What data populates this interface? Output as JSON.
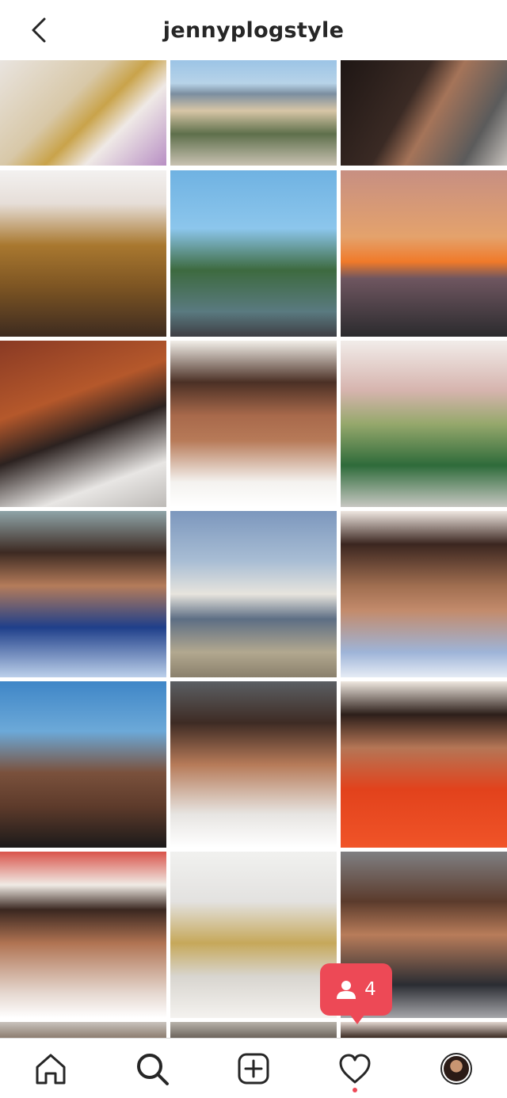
{
  "header": {
    "username": "jennyplogstyle",
    "back_icon": "chevron-left-icon"
  },
  "grid": {
    "posts": [
      {
        "name": "post-perfume-flatlay",
        "bg": "linear-gradient(135deg,#e9e4df 0%,#d8c8a8 40%,#c9a34a 55%,#efe9e6 70%,#b88fc4 100%)"
      },
      {
        "name": "post-coastline",
        "bg": "linear-gradient(180deg,#9cc4e6 0%,#b7d3e8 22%,#7b8ea0 32%,#d7c6a6 48%,#5e6f4b 70%,#c9c2b2 100%)"
      },
      {
        "name": "post-portrait-dark",
        "bg": "linear-gradient(120deg,#1e1614 0%,#3a2a24 40%,#a57459 55%,#5b5b5b 80%,#c7c2bd 100%)"
      },
      {
        "name": "post-leopard-dress",
        "bg": "linear-gradient(180deg,#f3f1f0 0%,#e6ded8 20%,#a9782f 45%,#7d5523 70%,#3d2b20 100%)"
      },
      {
        "name": "post-palm-street",
        "bg": "linear-gradient(180deg,#6fb2e2 0%,#8cc6ec 35%,#3d6a3f 60%,#5a7a80 85%,#3e3e44 100%)"
      },
      {
        "name": "post-sunset",
        "bg": "linear-gradient(180deg,#c78f82 0%,#e4a26c 40%,#f07a2a 55%,#6f5660 65%,#2b2b2e 100%)"
      },
      {
        "name": "post-chocolaterie",
        "bg": "linear-gradient(160deg,#8a3a24 0%,#b5582b 35%,#2c2220 55%,#e8e6e4 80%,#bdbab7 100%)"
      },
      {
        "name": "post-red-lips",
        "bg": "linear-gradient(180deg,#f2efe9 0%,#4b3025 25%,#a8694b 45%,#b77a58 60%,#f4f2ef 85%,#ffffff 100%)"
      },
      {
        "name": "post-patio",
        "bg": "linear-gradient(180deg,#f1ece9 0%,#d6b4ae 30%,#96a86c 50%,#2e6b3a 75%,#c7c7c2 100%)"
      },
      {
        "name": "post-smile",
        "bg": "linear-gradient(180deg,#8fa4a8 0%,#3d2a22 25%,#b57c5a 45%,#1f3f8a 70%,#bcd0ea 100%)"
      },
      {
        "name": "post-beach-sun",
        "bg": "linear-gradient(180deg,#7c97bd 0%,#a8bdd4 30%,#e7e4dd 50%,#5d6e84 65%,#b2a88f 85%,#8a806c 100%)"
      },
      {
        "name": "post-floral-top",
        "bg": "linear-gradient(180deg,#efe7e1 0%,#3b2620 20%,#a06e50 45%,#c38b6c 60%,#9eb4d8 85%,#e6ecf5 100%)"
      },
      {
        "name": "post-beach-selfie",
        "bg": "linear-gradient(180deg,#3f86c7 0%,#6ca9d8 30%,#7a513c 55%,#5e3b2b 75%,#1c1a1a 100%)"
      },
      {
        "name": "post-car-selfie",
        "bg": "linear-gradient(180deg,#5b5f63 0%,#3e2b24 25%,#b67a58 50%,#e7e5e2 80%,#ffffff 100%)"
      },
      {
        "name": "post-red-sweater",
        "bg": "linear-gradient(180deg,#efe8e0 0%,#2d1f1a 20%,#b57656 40%,#e2421c 65%,#f05428 100%)"
      },
      {
        "name": "post-bob-hair",
        "bg": "linear-gradient(180deg,#d9534a 0%,#f0ebe5 20%,#3a2720 35%,#b07352 55%,#e5d7cf 85%,#ffffff 100%)"
      },
      {
        "name": "post-vanity",
        "bg": "linear-gradient(180deg,#f1f1ef 0%,#e3e2e0 30%,#c6a85a 55%,#d8d5cf 75%,#f4f2ef 100%)"
      },
      {
        "name": "post-car-bangs",
        "bg": "linear-gradient(180deg,#7f7f82 0%,#5b3b2c 30%,#b87c5a 50%,#2b2d33 80%,#a6a6aa 100%)"
      },
      {
        "name": "post-partial-1",
        "bg": "linear-gradient(180deg,#c9c3bd 0%,#8c7d70 100%)"
      },
      {
        "name": "post-partial-2",
        "bg": "linear-gradient(180deg,#b8b3ab 0%,#6c645c 100%)"
      },
      {
        "name": "post-partial-3",
        "bg": "linear-gradient(180deg,#e2d6cf 0%,#3a2a22 100%)"
      }
    ]
  },
  "notification": {
    "icon": "person-icon",
    "count": "4",
    "color": "#ed4956"
  },
  "nav": {
    "items": [
      "home-icon",
      "search-icon",
      "add-post-icon",
      "heart-icon",
      "profile-avatar"
    ]
  }
}
